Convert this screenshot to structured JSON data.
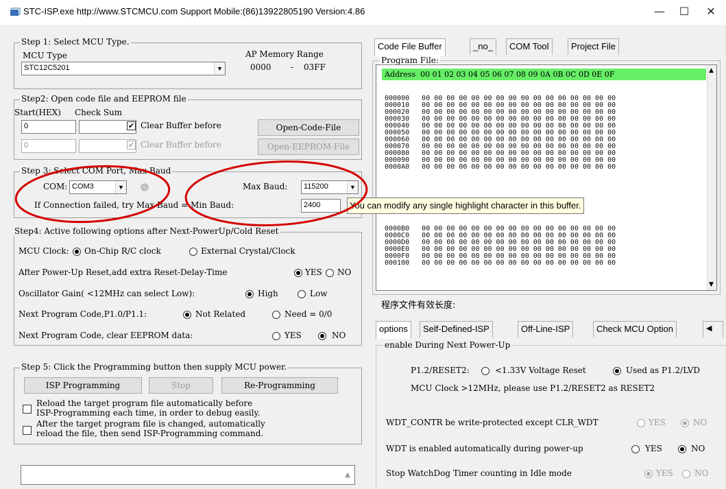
{
  "window": {
    "title": "STC-ISP.exe http://www.STCMCU.com  Support Mobile:(86)13922805190 Version:4.86",
    "controls": {
      "minimize": "—",
      "maximize": "☐",
      "close": "✕"
    }
  },
  "step1": {
    "legend": "Step 1: Select MCU Type.",
    "mcu_type_label": "MCU Type",
    "mcu_type_value": "STC12C5201",
    "ap_label": "AP Memory Range",
    "ap_start": "0000",
    "ap_dash": "-",
    "ap_end": "03FF"
  },
  "step2": {
    "legend": "Step2: Open code file and EEPROM file",
    "start_label": "Start(HEX)",
    "checksum_label": "Check Sum",
    "start1": "0",
    "start2": "0",
    "clear_buffer1": "Clear Buffer before",
    "clear_buffer2": "Clear Buffer before",
    "open_code": "Open-Code-File",
    "open_eeprom": "Open-EEPROM-File"
  },
  "step3": {
    "legend": "Step 3: Select COM Port, Max Baud",
    "com_label": "COM:",
    "com_value": "COM3",
    "max_baud_label": "Max Baud:",
    "max_baud_value": "115200",
    "fail_label": "If Connection failed, try Max Baud = Min Baud:",
    "min_baud_value": "2400"
  },
  "step4": {
    "legend": "Step4: Active following options after Next-PowerUp/Cold Reset",
    "clock_label": "MCU Clock:",
    "clock_opt1": "On-Chip R/C clock",
    "clock_opt2": "External Crystal/Clock",
    "reset_label": "After Power-Up Reset,add extra Reset-Delay-Time",
    "yes": "YES",
    "no": "NO",
    "osc_label": "Oscillator Gain( <12MHz can select Low):",
    "high": "High",
    "low": "Low",
    "next_p1_label": "Next Program Code,P1.0/P1.1:",
    "not_related": "Not Related",
    "need": "Need = 0/0",
    "eeprom_label": "Next Program Code, clear EEPROM data:",
    "yes2": "YES",
    "no2": "NO"
  },
  "step5": {
    "legend": "Step 5: Click the Programming button then supply MCU power.",
    "isp": "ISP Programming",
    "stop": "Stop",
    "reprog": "Re-Programming",
    "reload1a": "Reload the target program file automatically before",
    "reload1b": "ISP-Programming each time, in order to debug easily.",
    "reload2a": "After the target program file is changed, automatically",
    "reload2b": "reload the file, then send ISP-Programming command."
  },
  "buffer_tabs": [
    "Code File Buffer",
    "_no_",
    "COM Tool",
    "Project File"
  ],
  "program_file_label": "Program File:",
  "hex": {
    "header": "Address  00 01 02 03 04 05 06 07 08 09 0A 0B 0C 0D 0E 0F",
    "rows": [
      "000000   00 00 00 00 00 00 00 00 00 00 00 00 00 00 00 00",
      "000010   00 00 00 00 00 00 00 00 00 00 00 00 00 00 00 00",
      "000020   00 00 00 00 00 00 00 00 00 00 00 00 00 00 00 00",
      "000030   00 00 00 00 00 00 00 00 00 00 00 00 00 00 00 00",
      "000040   00 00 00 00 00 00 00 00 00 00 00 00 00 00 00 00",
      "000050   00 00 00 00 00 00 00 00 00 00 00 00 00 00 00 00",
      "000060   00 00 00 00 00 00 00 00 00 00 00 00 00 00 00 00",
      "000070   00 00 00 00 00 00 00 00 00 00 00 00 00 00 00 00",
      "000080   00 00 00 00 00 00 00 00 00 00 00 00 00 00 00 00",
      "000090   00 00 00 00 00 00 00 00 00 00 00 00 00 00 00 00",
      "0000A0   00 00 00 00 00 00 00 00 00 00 00 00 00 00 00 00",
      "0000B0   00 00 00 00 00 00 00 00 00 00 00 00 00 00 00 00",
      "0000C0   00 00 00 00 00 00 00 00 00 00 00 00 00 00 00 00",
      "0000D0   00 00 00 00 00 00 00 00 00 00 00 00 00 00 00 00",
      "0000E0   00 00 00 00 00 00 00 00 00 00 00 00 00 00 00 00",
      "0000F0   00 00 00 00 00 00 00 00 00 00 00 00 00 00 00 00",
      "000100   00 00 00 00 00 00 00 00 00 00 00 00 00 00 00 00"
    ]
  },
  "tooltip": "You can modify any single highlight character in this buffer.",
  "valid_length_label": "程序文件有效长度:",
  "options_tabs": [
    "options",
    "Self-Defined-ISP",
    "Off-Line-ISP",
    "Check MCU Option"
  ],
  "options": {
    "legend": "enable During Next Power-Up",
    "p12_label": "P1.2/RESET2:",
    "p12_opt1": "<1.33V Voltage Reset",
    "p12_opt2": "Used as P1.2/LVD",
    "mcu_clock_note": "MCU Clock >12MHz, please use P1.2/RESET2 as RESET2",
    "wdt_contr": "WDT_CONTR be write-protected except CLR_WDT",
    "wdt_auto": "WDT is enabled automatically during power-up",
    "wdt_idle": "Stop WatchDog Timer counting in Idle mode",
    "yes": "YES",
    "no": "NO"
  },
  "colors": {
    "hex_header": "#66ee66",
    "annotation": "#d40000",
    "tooltip_bg": "#ffffe1"
  }
}
